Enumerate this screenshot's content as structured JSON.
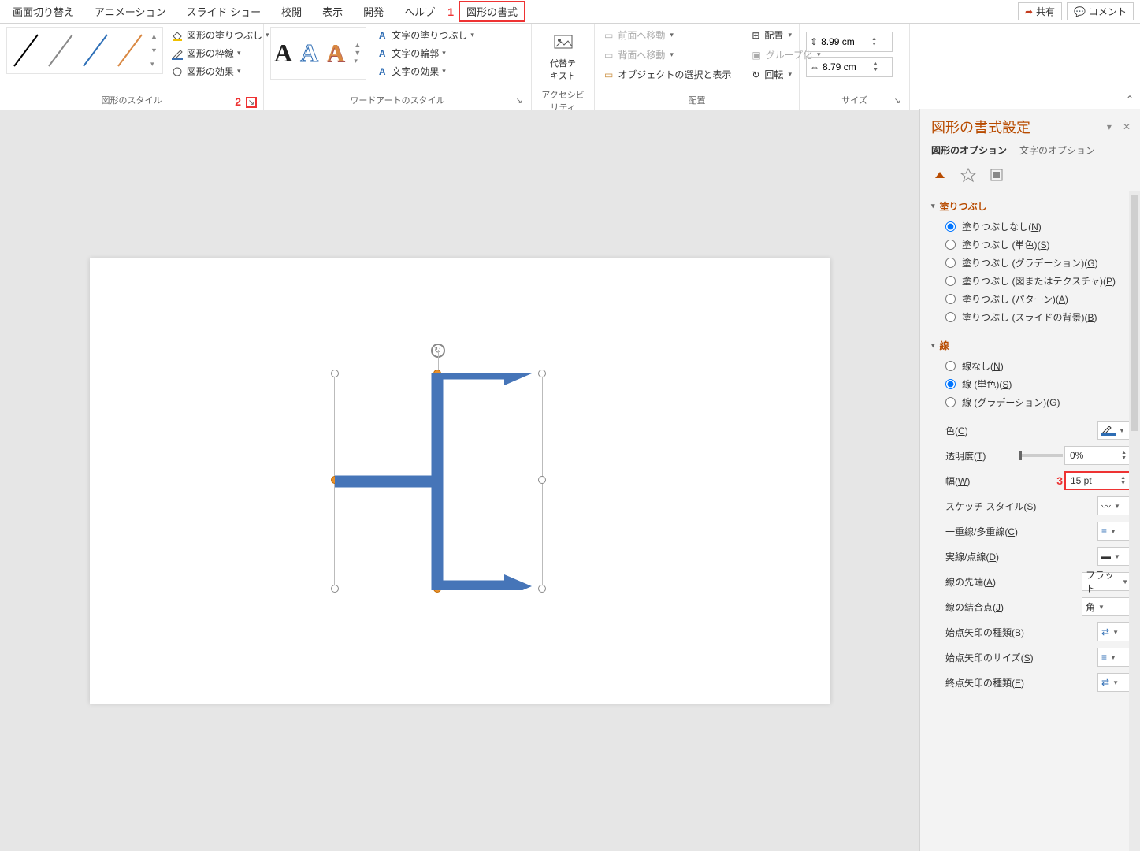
{
  "tabs": {
    "transition": "画面切り替え",
    "animation": "アニメーション",
    "slideshow": "スライド ショー",
    "review": "校閲",
    "view": "表示",
    "developer": "開発",
    "help": "ヘルプ",
    "shape_format": "図形の書式"
  },
  "callouts": {
    "one": "1",
    "two": "2",
    "three": "3"
  },
  "top_right": {
    "share": "共有",
    "comment": "コメント"
  },
  "ribbon": {
    "shape_styles": {
      "fill": "図形の塗りつぶし",
      "outline": "図形の枠線",
      "effects": "図形の効果",
      "label": "図形のスタイル"
    },
    "wordart": {
      "text_fill": "文字の塗りつぶし",
      "text_outline": "文字の輪郭",
      "text_effects": "文字の効果",
      "label": "ワードアートのスタイル"
    },
    "alt_text": {
      "btn": "代替テキスト",
      "label": "アクセシビリティ"
    },
    "arrange": {
      "bring_forward": "前面へ移動",
      "send_backward": "背面へ移動",
      "selection_pane": "オブジェクトの選択と表示",
      "align": "配置",
      "group": "グループ化",
      "rotate": "回転",
      "label": "配置"
    },
    "size": {
      "height": "8.99 cm",
      "width": "8.79 cm",
      "label": "サイズ"
    }
  },
  "pane": {
    "title": "図形の書式設定",
    "tab_shape": "図形のオプション",
    "tab_text": "文字のオプション",
    "fill": {
      "header": "塗りつぶし",
      "none": "塗りつぶしなし",
      "none_u": "N",
      "solid": "塗りつぶし (単色)",
      "solid_u": "S",
      "gradient": "塗りつぶし (グラデーション)",
      "gradient_u": "G",
      "picture": "塗りつぶし (図またはテクスチャ)",
      "picture_u": "P",
      "pattern": "塗りつぶし (パターン)",
      "pattern_u": "A",
      "slidebg": "塗りつぶし (スライドの背景)",
      "slidebg_u": "B"
    },
    "line": {
      "header": "線",
      "none": "線なし",
      "none_u": "N",
      "solid": "線 (単色)",
      "solid_u": "S",
      "gradient": "線 (グラデーション)",
      "gradient_u": "G",
      "color": "色",
      "color_u": "C",
      "transparency": "透明度",
      "transparency_u": "T",
      "transparency_val": "0%",
      "width": "幅",
      "width_u": "W",
      "width_val": "15 pt",
      "sketch": "スケッチ スタイル",
      "sketch_u": "S",
      "compound": "一重線/多重線",
      "compound_u": "C",
      "dash": "実線/点線",
      "dash_u": "D",
      "cap": "線の先端",
      "cap_u": "A",
      "cap_val": "フラット",
      "join": "線の結合点",
      "join_u": "J",
      "join_val": "角",
      "begin_type": "始点矢印の種類",
      "begin_type_u": "B",
      "begin_size": "始点矢印のサイズ",
      "begin_size_u": "S",
      "end_type": "終点矢印の種類",
      "end_type_u": "E"
    }
  }
}
